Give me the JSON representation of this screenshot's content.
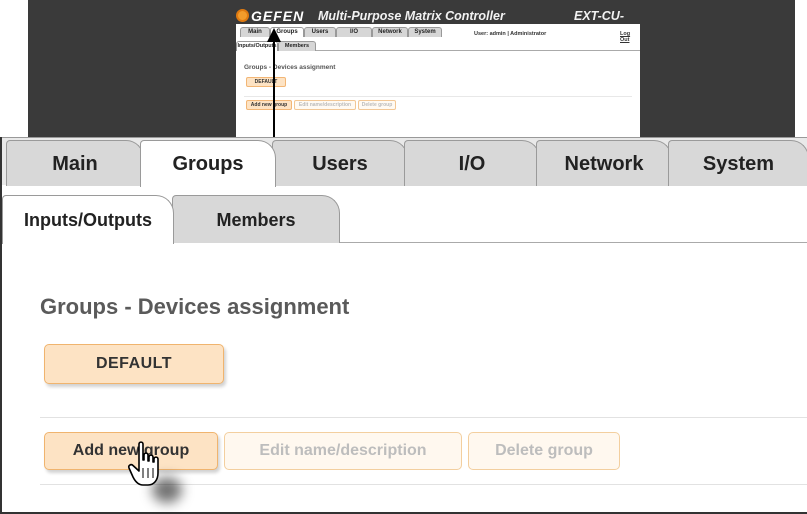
{
  "thumbnail": {
    "brand": "GEFEN",
    "app_title": "Multi-Purpose Matrix Controller",
    "model": "EXT-CU-LAN",
    "tabs": [
      "Main",
      "Groups",
      "Users",
      "I/O",
      "Network",
      "System"
    ],
    "user_info": "User: admin  |  Administrator",
    "logout": "Log Out",
    "subtabs": [
      "Inputs/Outputs",
      "Members"
    ],
    "heading": "Groups - Devices assignment",
    "group": "DEFAULT",
    "buttons": [
      "Add new group",
      "Edit name/description",
      "Delete group"
    ]
  },
  "tabs": [
    {
      "label": "Main"
    },
    {
      "label": "Groups",
      "active": true
    },
    {
      "label": "Users"
    },
    {
      "label": "I/O"
    },
    {
      "label": "Network"
    },
    {
      "label": "System"
    }
  ],
  "subtabs": [
    {
      "label": "Inputs/Outputs",
      "active": true
    },
    {
      "label": "Members"
    }
  ],
  "section": {
    "heading": "Groups - Devices assignment",
    "groups": [
      "DEFAULT"
    ]
  },
  "actions": {
    "add": "Add new group",
    "edit": "Edit name/description",
    "delete": "Delete group"
  },
  "colors": {
    "button_fill": "#fde3c4",
    "button_border": "#f0b46e",
    "disabled_text": "#bdbdbd",
    "dark_frame": "#3a3a3a"
  },
  "icons": {
    "cursor": "hand-pointer-icon",
    "arrow": "up-arrow-icon",
    "logo": "gefen-logo-icon"
  }
}
